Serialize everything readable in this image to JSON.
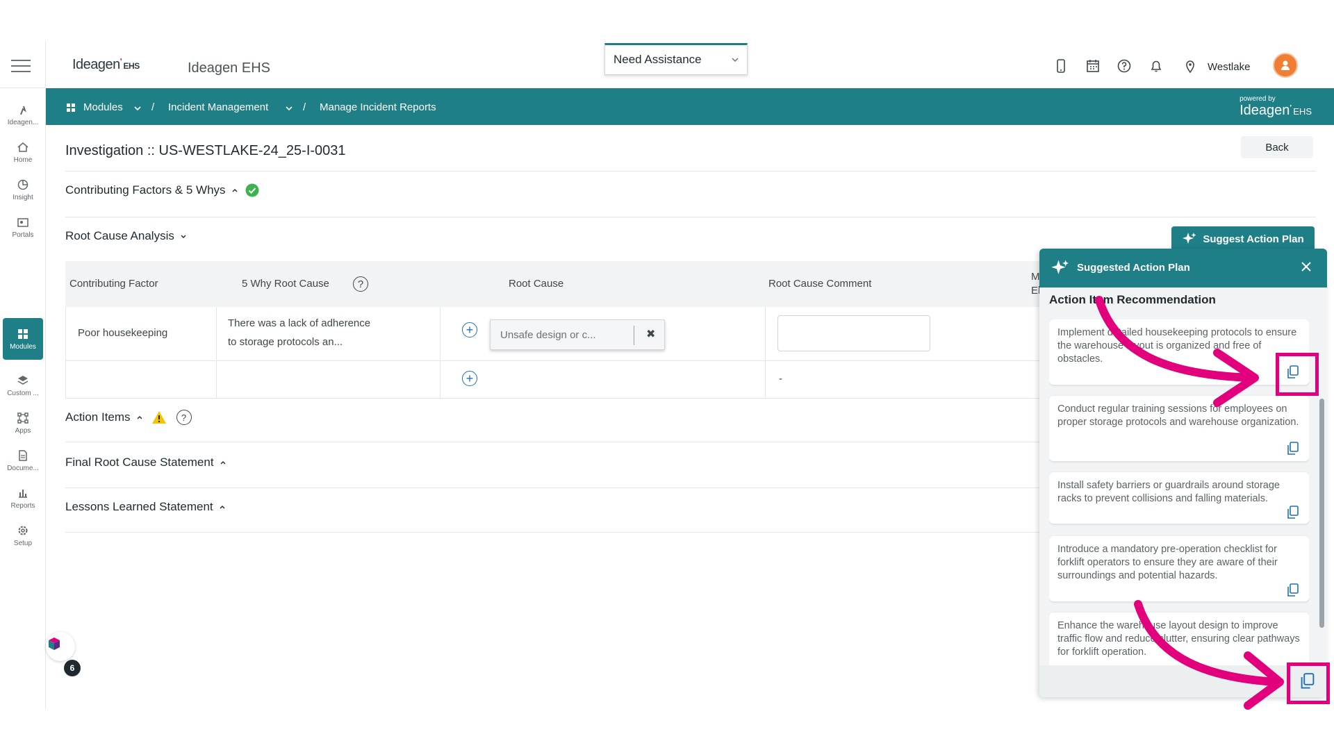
{
  "rail": {
    "items": [
      {
        "label": "Ideagen...",
        "icon": "ideagen-logo-icon"
      },
      {
        "label": "Home",
        "icon": "home-icon"
      },
      {
        "label": "Insight",
        "icon": "pie-chart-icon"
      },
      {
        "label": "Portals",
        "icon": "id-card-icon"
      },
      {
        "label": "Modules",
        "icon": "grid-icon"
      },
      {
        "label": "Custom ...",
        "icon": "layers-icon"
      },
      {
        "label": "Apps",
        "icon": "apps-icon"
      },
      {
        "label": "Docume...",
        "icon": "document-icon"
      },
      {
        "label": "Reports",
        "icon": "bar-chart-icon"
      },
      {
        "label": "Setup",
        "icon": "gear-icon"
      }
    ]
  },
  "header": {
    "logo_text": "Ideagen",
    "logo_sub": "EHS",
    "app_name": "Ideagen EHS",
    "assist_label": "Need Assistance",
    "location": "Westlake"
  },
  "breadcrumb": {
    "modules": "Modules",
    "incident_mgmt": "Incident Management",
    "sep": "/",
    "current": "Manage Incident Reports",
    "powered_by": "powered by",
    "powered_logo": "Ideagen",
    "powered_sub": "EHS"
  },
  "main": {
    "title": "Investigation :: US-WESTLAKE-24_25-I-0031",
    "back_label": "Back",
    "sections": {
      "contributing": "Contributing Factors & 5 Whys",
      "rca": "Root Cause Analysis",
      "action_items": "Action Items",
      "final_statement": "Final Root Cause Statement",
      "lessons": "Lessons Learned Statement"
    },
    "suggest_btn": "Suggest Action Plan",
    "table": {
      "headers": [
        "Contributing Factor",
        "5 Why Root Cause",
        "Root Cause",
        "Root Cause Comment",
        "M",
        "El"
      ],
      "rows": [
        {
          "factor": "Poor housekeeping",
          "why_1": "There was a lack of adherence",
          "why_2": "to storage protocols an...",
          "root_cause": "Unsafe design or c...",
          "remove": "✖"
        },
        {
          "factor": "",
          "why_1": "",
          "why_2": "",
          "comment": "-"
        }
      ]
    }
  },
  "panel": {
    "title": "Suggested Action Plan",
    "subtitle": "Action Item Recommendation",
    "items": [
      "Implement detailed housekeeping protocols to ensure the warehouse layout is organized and free of obstacles.",
      "Conduct regular training sessions for employees on proper storage protocols and warehouse organization.",
      "Install safety barriers or guardrails around storage racks to prevent collisions and falling materials.",
      "Introduce a mandatory pre-operation checklist for forklift operators to ensure they are aware of their surroundings and potential hazards.",
      "Enhance the warehouse layout design to improve traffic flow and reduce clutter, ensuring clear pathways for forklift operation."
    ]
  },
  "fab": {
    "count": "6"
  },
  "colors": {
    "teal": "#1e7f86",
    "highlight": "#e3007d",
    "success": "#3fb24f",
    "warning": "#f5c400"
  }
}
